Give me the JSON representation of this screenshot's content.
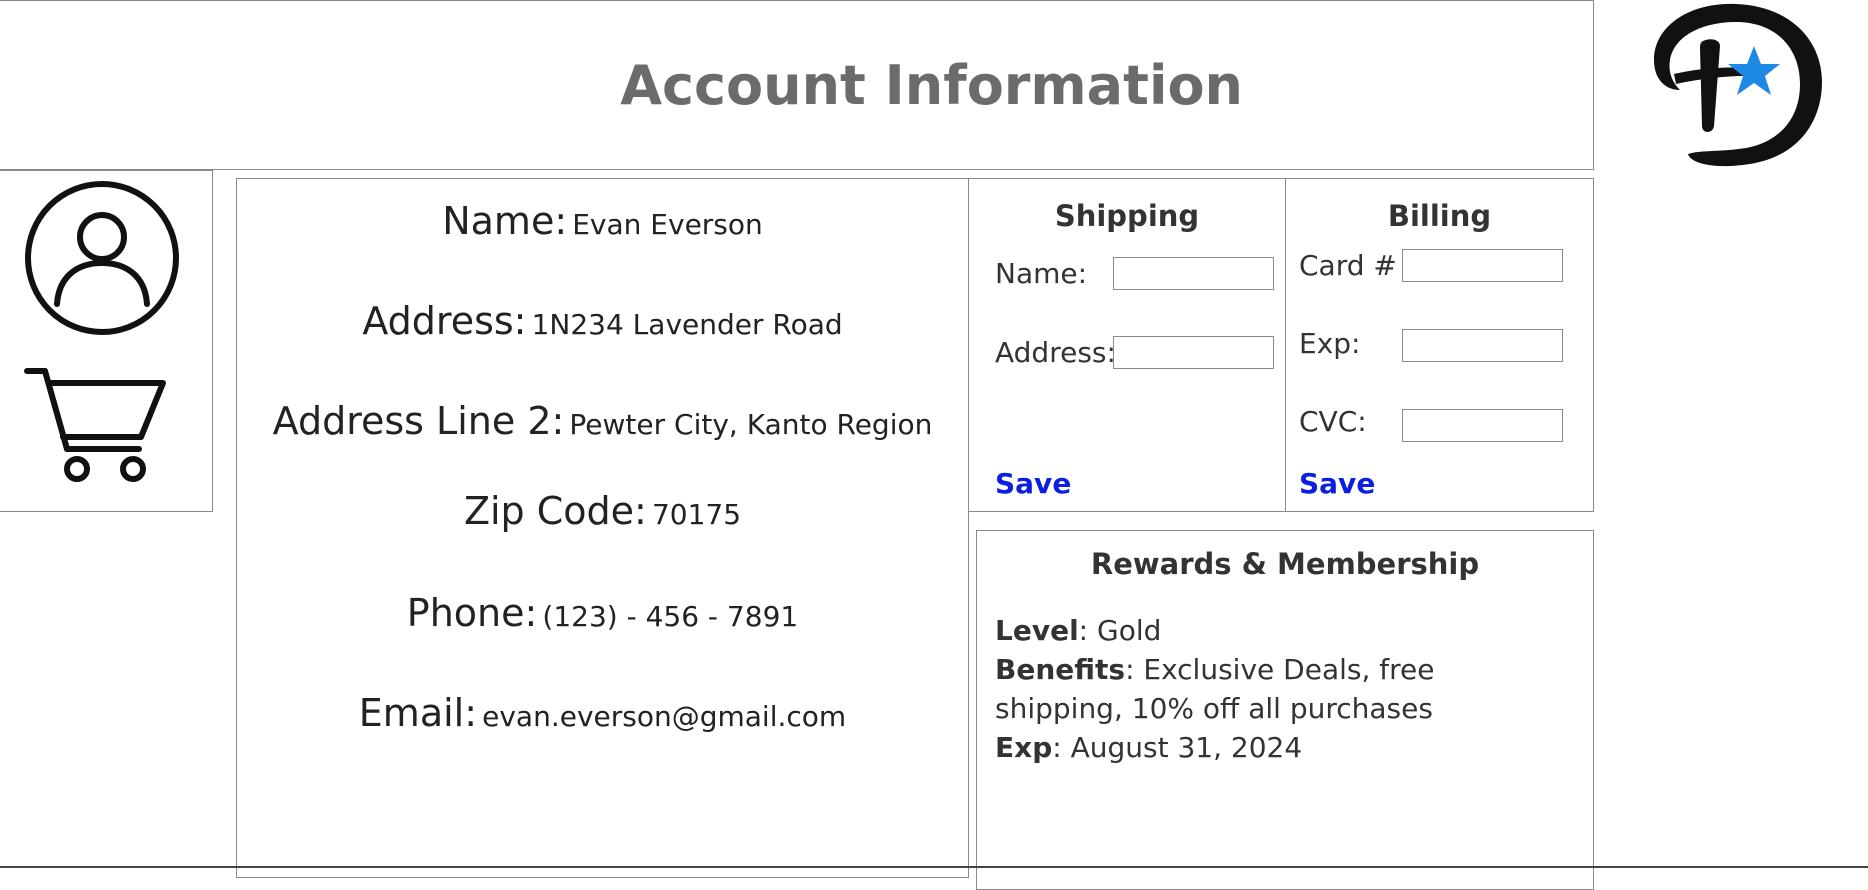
{
  "header": {
    "title": "Account Information"
  },
  "logo": {
    "colors": {
      "ink": "#111111",
      "star": "#1e88e5"
    }
  },
  "sidebar": {
    "items": [
      {
        "name": "profile",
        "icon": "user-circle-icon"
      },
      {
        "name": "cart",
        "icon": "shopping-cart-icon"
      }
    ]
  },
  "account": {
    "name_label": "Name:",
    "name_value": "Evan Everson",
    "address_label": "Address:",
    "address_value": "1N234 Lavender Road",
    "address2_label": "Address Line 2:",
    "address2_value": "Pewter City, Kanto Region",
    "zip_label": "Zip Code:",
    "zip_value": "70175",
    "phone_label": "Phone:",
    "phone_value": "(123) - 456 - 7891",
    "email_label": "Email:",
    "email_value": "evan.everson@gmail.com"
  },
  "shipping": {
    "title": "Shipping",
    "name_label": "Name:",
    "name_value": "",
    "address_label": "Address:",
    "address_value": "",
    "save_label": "Save"
  },
  "billing": {
    "title": "Billing",
    "card_label": "Card #",
    "card_value": "",
    "exp_label": "Exp:",
    "exp_value": "",
    "cvc_label": "CVC:",
    "cvc_value": "",
    "save_label": "Save"
  },
  "rewards": {
    "title": "Rewards & Membership",
    "level_label": "Level",
    "level_value": ": Gold",
    "benefits_label": "Benefits",
    "benefits_value": ": Exclusive Deals, free shipping, 10% off all purchases",
    "exp_label": "Exp",
    "exp_value": ": August 31, 2024"
  },
  "colors": {
    "link": "#0a1fe0",
    "title": "#6b6b6b",
    "border": "#8a8a8a"
  }
}
